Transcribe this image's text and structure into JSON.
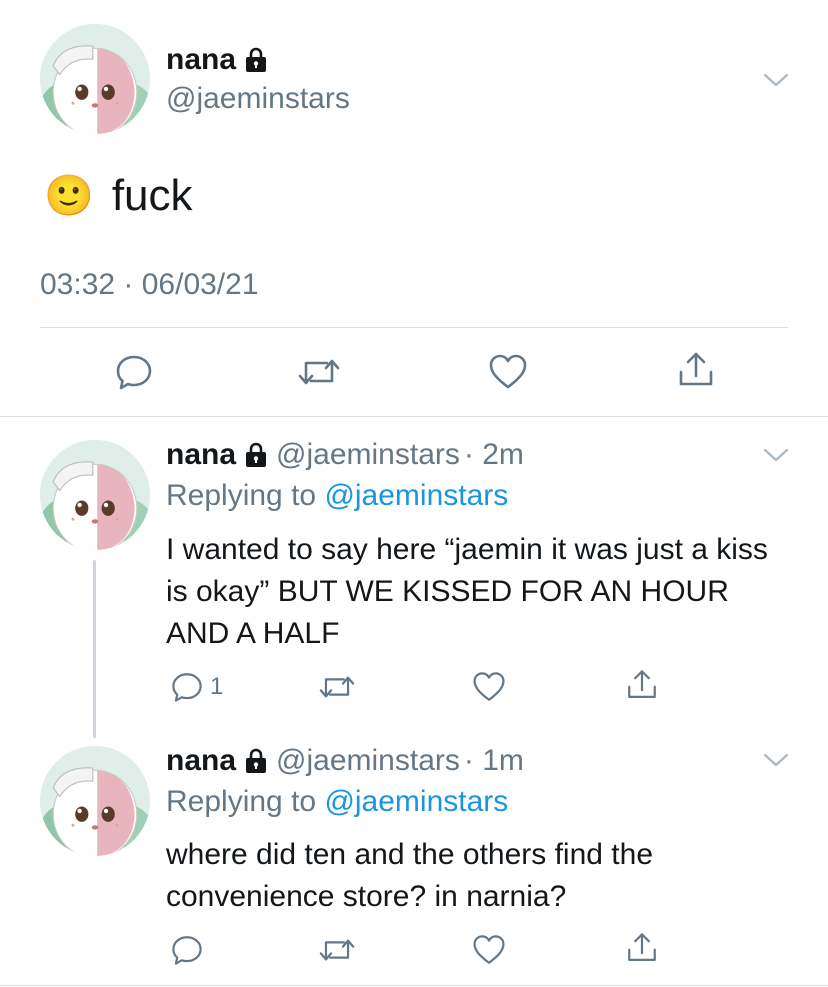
{
  "main_tweet": {
    "name": "nana",
    "handle": "@jaeminstars",
    "emoji": "🙂",
    "text": "fuck",
    "timestamp": "03:32 · 06/03/21"
  },
  "replies": [
    {
      "name": "nana",
      "handle": "@jaeminstars",
      "time": "· 2m",
      "replying_label": "Replying to",
      "replying_to": "@jaeminstars",
      "text": "I wanted to say here “jaemin it was just a kiss is okay” BUT WE KISSED FOR AN HOUR AND A HALF",
      "reply_count": "1"
    },
    {
      "name": "nana",
      "handle": "@jaeminstars",
      "time": "· 1m",
      "replying_label": "Replying to",
      "replying_to": "@jaeminstars",
      "text": "where did ten and the others find the convenience store? in narnia?",
      "reply_count": ""
    }
  ],
  "colors": {
    "text_primary": "#14171a",
    "text_secondary": "#657786",
    "link": "#1b95e0",
    "divider": "#dadde1",
    "thread_line": "#ccd6dd"
  },
  "icons": [
    "lock-icon",
    "chevron-down-icon",
    "reply-icon",
    "retweet-icon",
    "like-icon",
    "share-icon",
    "avatar-image"
  ]
}
